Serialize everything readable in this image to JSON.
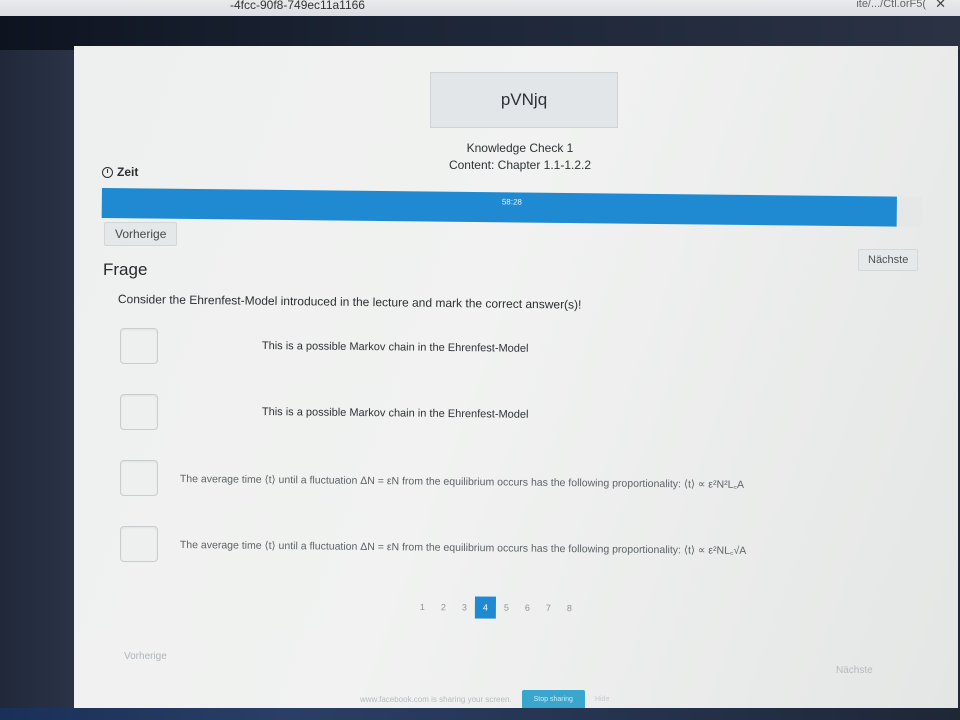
{
  "browser": {
    "url_fragment": "-4fcc-90f8-749ec11a1166",
    "url_right_fragment": "ite/.../Ctl.orF5(",
    "close_label": "✕"
  },
  "quiz": {
    "title": "pVNjq",
    "subtitle_line1": "Knowledge Check 1",
    "subtitle_line2": "Content: Chapter 1.1-1.2.2",
    "timer_label": "Zeit",
    "timer_value": "58:28",
    "timer_progress": 0.97,
    "prev_label": "Vorherige",
    "next_label": "Nächste",
    "section_label": "Frage",
    "question_text": "Consider the Ehrenfest-Model introduced in the lecture and mark the correct answer(s)!",
    "options": [
      {
        "label": "This is a possible Markov chain in the Ehrenfest-Model",
        "checked": false
      },
      {
        "label": "This is a possible Markov chain in the Ehrenfest-Model",
        "checked": false
      },
      {
        "label": "The average time ⟨t⟩  until a fluctuation ΔN = εN  from the equilibrium occurs has the following proportionality: ⟨t⟩ ∝ ε²N²L꜀A",
        "checked": false
      },
      {
        "label": "The average time ⟨t⟩  until a fluctuation ΔN = εN  from the equilibrium occurs has the following proportionality: ⟨t⟩ ∝ ε²NL꜀√A",
        "checked": false
      }
    ],
    "pages": [
      "1",
      "2",
      "3",
      "4",
      "5",
      "6",
      "7",
      "8"
    ],
    "current_page": "4",
    "bottom_prev_label": "Vorherige",
    "bottom_next_label": "Nächste"
  },
  "share_bar": {
    "text": "www.facebook.com is sharing your screen.",
    "stop_label": "Stop sharing",
    "hide_label": "Hide"
  },
  "colors": {
    "accent": "#1f8ad1",
    "page_bg": "#eef0ef"
  }
}
